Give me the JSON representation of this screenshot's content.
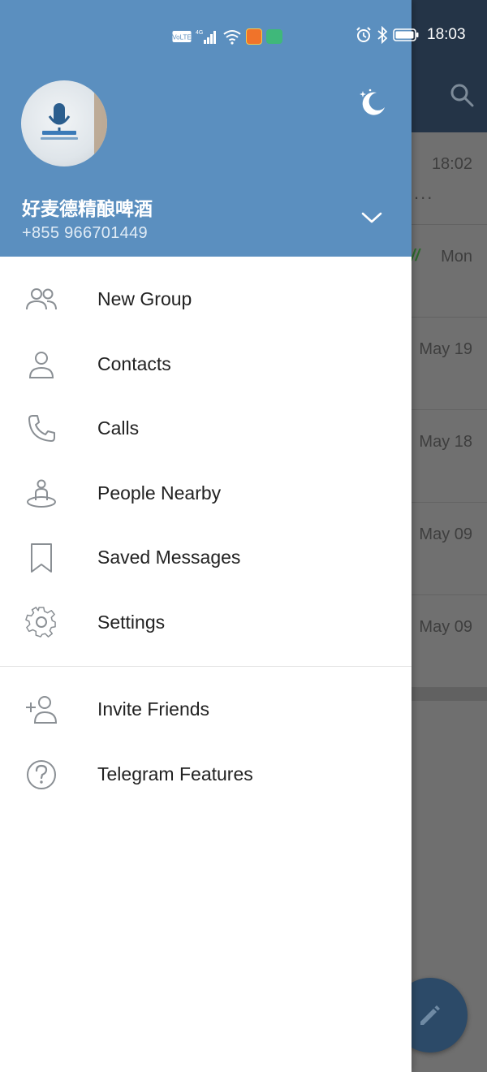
{
  "status_bar": {
    "time": "18:03",
    "icons": [
      "volte-icon",
      "signal-4g-icon",
      "wifi-icon",
      "app-notification-icon",
      "app-notification-icon",
      "alarm-icon",
      "bluetooth-icon",
      "battery-icon"
    ],
    "volte_label": "VoLTE",
    "network_label": "4G"
  },
  "drawer": {
    "profile": {
      "name": "好麦德精酿啤酒",
      "phone": "+855 966701449"
    },
    "menu": [
      {
        "label": "New Group",
        "icon": "new-group-icon"
      },
      {
        "label": "Contacts",
        "icon": "contacts-icon"
      },
      {
        "label": "Calls",
        "icon": "calls-icon"
      },
      {
        "label": "People Nearby",
        "icon": "people-nearby-icon"
      },
      {
        "label": "Saved Messages",
        "icon": "saved-messages-icon"
      },
      {
        "label": "Settings",
        "icon": "settings-icon"
      }
    ],
    "menu_secondary": [
      {
        "label": "Invite Friends",
        "icon": "invite-friends-icon"
      },
      {
        "label": "Telegram Features",
        "icon": "help-icon"
      }
    ]
  },
  "chat_list": {
    "rows": [
      {
        "time": "18:02",
        "preview": "..."
      },
      {
        "time": "Mon",
        "preview": ""
      },
      {
        "time": "May 19",
        "preview": ""
      },
      {
        "time": "May 18",
        "preview": ""
      },
      {
        "time": "May 09",
        "preview": ""
      },
      {
        "time": "May 09",
        "preview": ""
      }
    ]
  },
  "colors": {
    "drawer_header": "#5b8fbf",
    "app_header": "#243447",
    "accent": "#2c4a68"
  }
}
